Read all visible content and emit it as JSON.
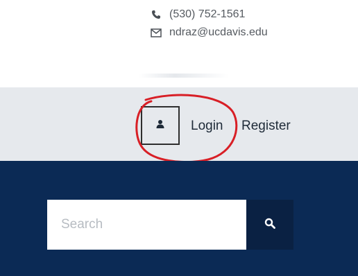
{
  "contact": {
    "phone": "(530) 752-1561",
    "email": "ndraz@ucdavis.edu"
  },
  "account": {
    "login_label": "Login",
    "register_label": "Register"
  },
  "search": {
    "placeholder": "Search",
    "value": ""
  },
  "icons": {
    "phone": "phone-icon",
    "email": "envelope-icon",
    "user": "user-icon",
    "search": "search-icon"
  },
  "colors": {
    "login_bar": "#e6e9ed",
    "search_band": "#0b2a55",
    "search_button": "#0a2143",
    "annotation_circle": "#d81f26"
  }
}
